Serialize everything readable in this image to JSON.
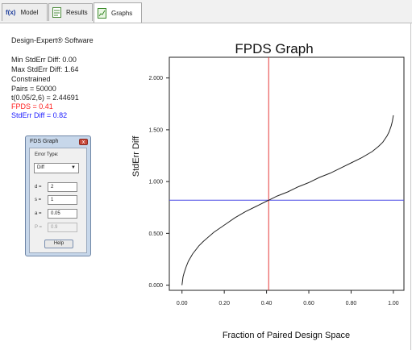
{
  "tabs": [
    {
      "label": "Model",
      "icon": "fx-icon"
    },
    {
      "label": "Results",
      "icon": "results-icon"
    },
    {
      "label": "Graphs",
      "icon": "graphs-icon",
      "active": true
    }
  ],
  "tab_fx_glyph": "f(x)",
  "info": {
    "software": "Design-Expert® Software",
    "min_stderr": "Min StdErr Diff: 0.00",
    "max_stderr": "Max StdErr Diff: 1.64",
    "constrained": "Constrained",
    "pairs": "Pairs = 50000",
    "t_value": "t(0.05/2,6) = 2.44691",
    "fpds": "FPDS = 0.41",
    "stderr_diff": "StdErr Diff = 0.82"
  },
  "dialog": {
    "title": "FDS Graph",
    "close_glyph": "x",
    "error_type_label": "Error Type:",
    "error_type_value": "Diff",
    "d_label": "d =",
    "d_value": "2",
    "s_label": "s =",
    "s_value": "1",
    "a_label": "a =",
    "a_value": "0.05",
    "p_label": "P =",
    "p_value": "0.9",
    "help_button": "Help"
  },
  "colors": {
    "fpds_text": "#ff2020",
    "stderr_text": "#2020ff",
    "vline": "#e53939",
    "hline": "#4a4ae6",
    "curve": "#222222"
  },
  "chart_data": {
    "type": "line",
    "title": "FPDS Graph",
    "xlabel": "Fraction of Paired Design Space",
    "ylabel": "StdErr Diff",
    "xlim": [
      -0.06,
      1.05
    ],
    "ylim": [
      -0.05,
      2.2
    ],
    "x_ticks": [
      "0.00",
      "0.20",
      "0.40",
      "0.60",
      "0.80",
      "1.00"
    ],
    "y_ticks": [
      "0.000",
      "0.500",
      "1.000",
      "1.500",
      "2.000"
    ],
    "series": [
      {
        "x": [
          0.0,
          0.005,
          0.01,
          0.02,
          0.03,
          0.05,
          0.08,
          0.1,
          0.15,
          0.2,
          0.25,
          0.3,
          0.35,
          0.4,
          0.41,
          0.45,
          0.5,
          0.55,
          0.6,
          0.65,
          0.7,
          0.75,
          0.8,
          0.85,
          0.9,
          0.93,
          0.95,
          0.97,
          0.98,
          0.99,
          0.995,
          1.0
        ],
        "y": [
          0.0,
          0.08,
          0.12,
          0.18,
          0.23,
          0.3,
          0.38,
          0.42,
          0.51,
          0.58,
          0.65,
          0.71,
          0.76,
          0.81,
          0.82,
          0.86,
          0.9,
          0.95,
          0.99,
          1.04,
          1.08,
          1.13,
          1.18,
          1.23,
          1.29,
          1.34,
          1.38,
          1.44,
          1.48,
          1.54,
          1.58,
          1.64
        ]
      }
    ],
    "vline_x": 0.41,
    "hline_y": 0.82,
    "grid": false
  }
}
